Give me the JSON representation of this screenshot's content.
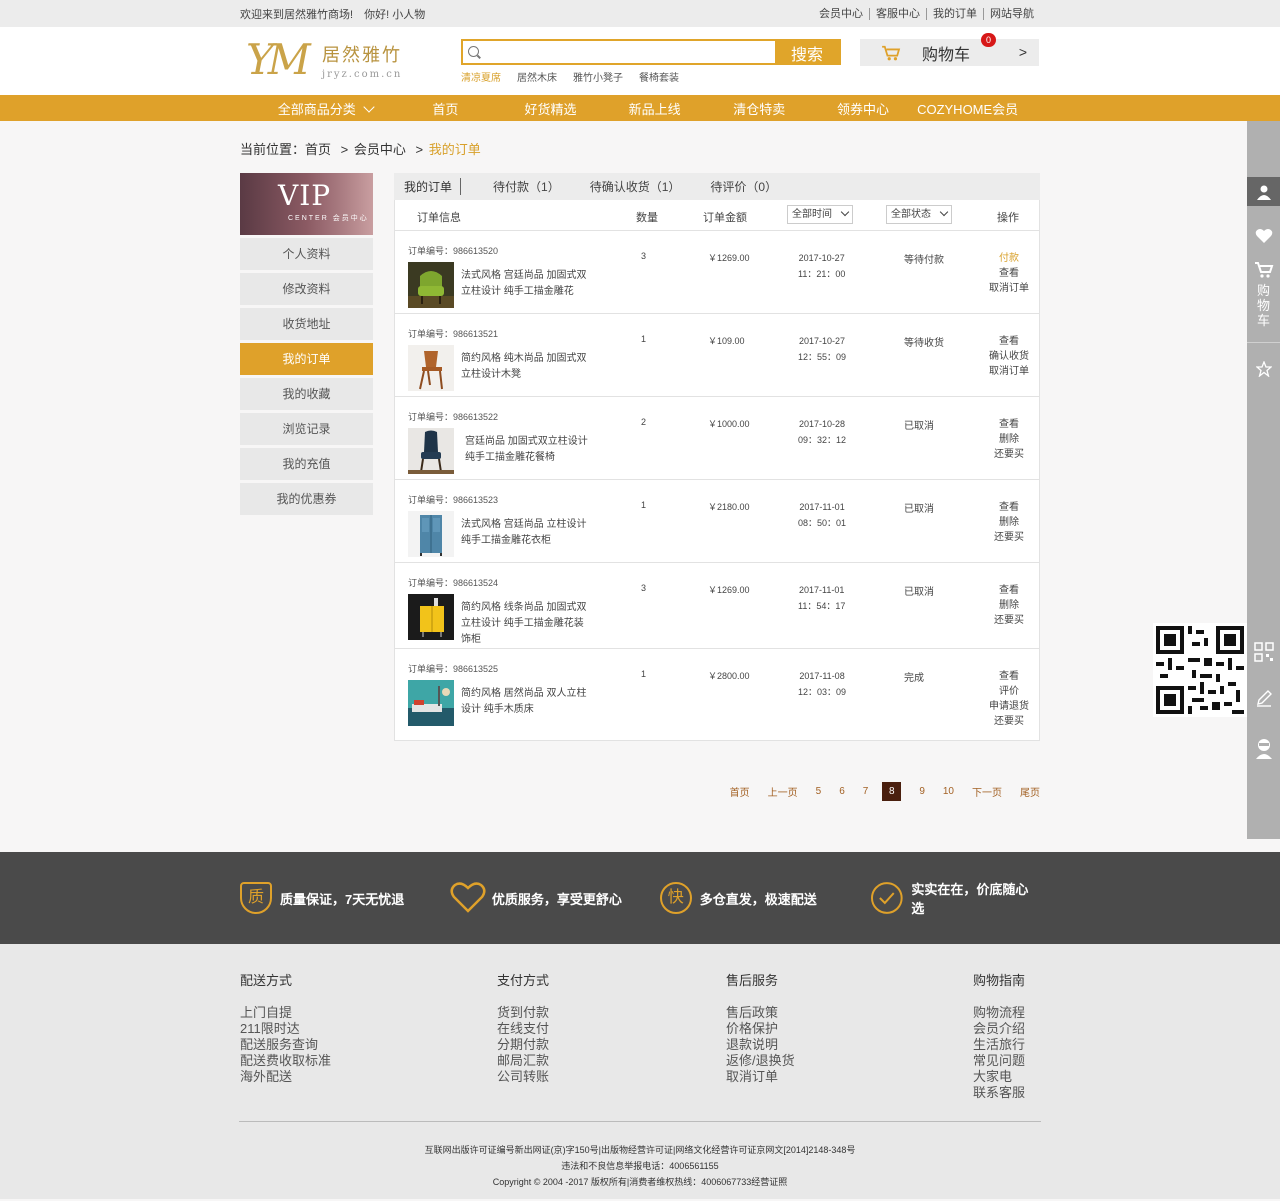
{
  "topbar": {
    "welcome": "欢迎来到居然雅竹商场!",
    "greeting": "你好! 小人物",
    "links": [
      "会员中心",
      "客服中心",
      "我的订单",
      "网站导航"
    ]
  },
  "header": {
    "logo_mark": "YM",
    "logo_cn": "居然雅竹",
    "logo_en": "jryz.com.cn",
    "search_placeholder": "",
    "search_button": "搜索",
    "hot_keywords": [
      "清凉夏席",
      "居然木床",
      "雅竹小凳子",
      "餐椅套装"
    ],
    "cart_label": "购物车",
    "cart_count": "0",
    "cart_arrow": ">"
  },
  "nav": {
    "items": [
      "全部商品分类",
      "首页",
      "好货精选",
      "新品上线",
      "清仓特卖",
      "领券中心",
      "COZYHOME会员"
    ]
  },
  "breadcrumb": {
    "prefix": "当前位置：首页",
    "sep1": ">",
    "level2": "会员中心",
    "sep2": ">",
    "current": "我的订单"
  },
  "sidebar": {
    "vip_title": "VIP",
    "vip_sub": "CENTER 会员中心",
    "items": [
      "个人资料",
      "修改资料",
      "收货地址",
      "我的订单",
      "我的收藏",
      "浏览记录",
      "我的充值",
      "我的优惠券"
    ],
    "active_index": 3
  },
  "tabs": [
    "我的订单",
    "待付款（1）",
    "待确认收货（1）",
    "待评价（0）"
  ],
  "table_head": {
    "info": "订单信息",
    "qty": "数量",
    "amount": "订单金额",
    "time_select": "全部时间",
    "status_select": "全部状态",
    "ops": "操作"
  },
  "orders": [
    {
      "no": "订单编号：986613520",
      "name": "法式风格 宫廷尚品 加固式双立柱设计 纯手工描金雕花",
      "qty": "3",
      "amount": "￥1269.00",
      "date": "2017-10-27",
      "time": "11：21：00",
      "status": "等待付款",
      "ops": [
        "付款",
        "查看",
        "取消订单"
      ],
      "thumb": "green-armchair"
    },
    {
      "no": "订单编号：986613521",
      "name": "简约风格 纯木尚品 加固式双立柱设计木凳",
      "qty": "1",
      "amount": "￥109.00",
      "date": "2017-10-27",
      "time": "12：55：09",
      "status": "等待收货",
      "ops": [
        "查看",
        "确认收货",
        "取消订单"
      ],
      "thumb": "wooden-chair"
    },
    {
      "no": "订单编号：986613522",
      "name": "宫廷尚品 加固式双立柱设计 纯手工描金雕花餐椅",
      "qty": "2",
      "amount": "￥1000.00",
      "date": "2017-10-28",
      "time": "09：32：12",
      "status": "已取消",
      "ops": [
        "查看",
        "删除",
        "还要买"
      ],
      "thumb": "leather-chair"
    },
    {
      "no": "订单编号：986613523",
      "name": "法式风格 宫廷尚品 立柱设计 纯手工描金雕花衣柜",
      "qty": "1",
      "amount": "￥2180.00",
      "date": "2017-11-01",
      "time": "08：50：01",
      "status": "已取消",
      "ops": [
        "查看",
        "删除",
        "还要买"
      ],
      "thumb": "blue-wardrobe"
    },
    {
      "no": "订单编号：986613524",
      "name": "简约风格 线条尚品 加固式双立柱设计 纯手工描金雕花装饰柜",
      "qty": "3",
      "amount": "￥1269.00",
      "date": "2017-11-01",
      "time": "11：54：17",
      "status": "已取消",
      "ops": [
        "查看",
        "删除",
        "还要买"
      ],
      "thumb": "yellow-cabinet"
    },
    {
      "no": "订单编号：986613525",
      "name": "简约风格 居然尚品 双人立柱设计 纯手木质床",
      "qty": "1",
      "amount": "￥2800.00",
      "date": "2017-11-08",
      "time": "12：03：09",
      "status": "完成",
      "ops": [
        "查看",
        "评价",
        "申请退货",
        "还要买"
      ],
      "thumb": "bedroom"
    }
  ],
  "pager": {
    "first": "首页",
    "prev": "上一页",
    "pages": [
      "5",
      "6",
      "7",
      "8",
      "9",
      "10"
    ],
    "current": "8",
    "next": "下一页",
    "last": "尾页"
  },
  "service_band": [
    {
      "icon": "质",
      "text": "质量保证，7天无忧退"
    },
    {
      "icon": "heart-icon",
      "text": "优质服务，享受更舒心"
    },
    {
      "icon": "快",
      "text": "多仓直发，极速配送"
    },
    {
      "icon": "check-icon",
      "text": "实实在在，价底随心选"
    }
  ],
  "footer_cols": [
    {
      "title": "配送方式",
      "links": [
        "上门自提",
        "211限时达",
        "配送服务查询",
        "配送费收取标准",
        "海外配送"
      ]
    },
    {
      "title": "支付方式",
      "links": [
        "货到付款",
        "在线支付",
        "分期付款",
        "邮局汇款",
        "公司转账"
      ]
    },
    {
      "title": "售后服务",
      "links": [
        "售后政策",
        "价格保护",
        "退款说明",
        "返修/退换货",
        "取消订单"
      ]
    },
    {
      "title": "购物指南",
      "links": [
        "购物流程",
        "会员介绍",
        "生活旅行",
        "常见问题",
        "大家电",
        "联系客服"
      ]
    }
  ],
  "copyright": {
    "line1": "互联网出版许可证编号新出网证(京)字150号|出版物经营许可证|网络文化经营许可证京网文[2014]2148-348号",
    "line2": "违法和不良信息举报电话：4006561155",
    "line3": "Copyright © 2004 -2017 版权所有|消费者维权热线：4006067733经营证照"
  },
  "right_bar": {
    "cart_label": "购物车",
    "items": [
      "user-icon",
      "heart-icon",
      "cart-icon",
      "star-icon",
      "qrcode-icon",
      "edit-icon",
      "service-icon"
    ]
  },
  "colors": {
    "accent": "#dfa12a",
    "dark_band": "#4a4a4a",
    "pager_active": "#4a1f0e"
  }
}
